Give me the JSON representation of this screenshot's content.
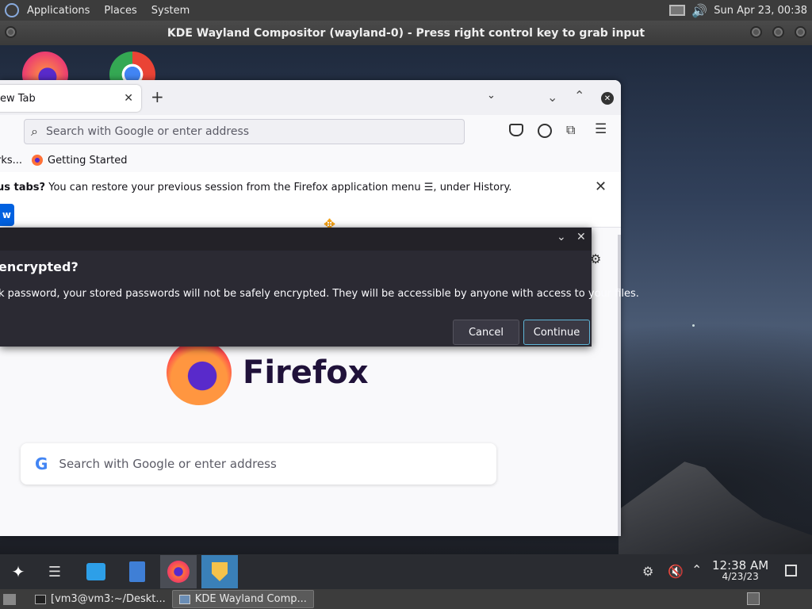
{
  "host_top": {
    "menu": [
      "Applications",
      "Places",
      "System"
    ],
    "datetime": "Sun Apr 23, 00:38"
  },
  "kde_window_title": "KDE Wayland Compositor (wayland-0) - Press right control key to grab input",
  "firefox": {
    "tab_label": "ew Tab",
    "url_placeholder": "Search with Google or enter address",
    "bookmarks": [
      "rks...",
      "Getting Started"
    ],
    "notice_bold": "us tabs?",
    "notice_text": " You can restore your previous session from the Firefox application menu ☰, under History.",
    "notice_button": "w",
    "brand": "Firefox",
    "newtab_search_placeholder": "Search with Google or enter address"
  },
  "dialog": {
    "heading": "encrypted?",
    "body": "k password, your stored passwords will not be safely encrypted. They will be accessible by anyone with access to your files.",
    "cancel": "Cancel",
    "continue": "Continue"
  },
  "clock": {
    "time": "12:38 AM",
    "date": "4/23/23"
  },
  "host_bottom": {
    "tasks": [
      "[vm3@vm3:~/Deskt...",
      "KDE Wayland Comp..."
    ]
  },
  "colors": {
    "accent": "#0061e0",
    "dialog_bg": "#2b2a33",
    "continue_border": "#5fb4d6"
  }
}
